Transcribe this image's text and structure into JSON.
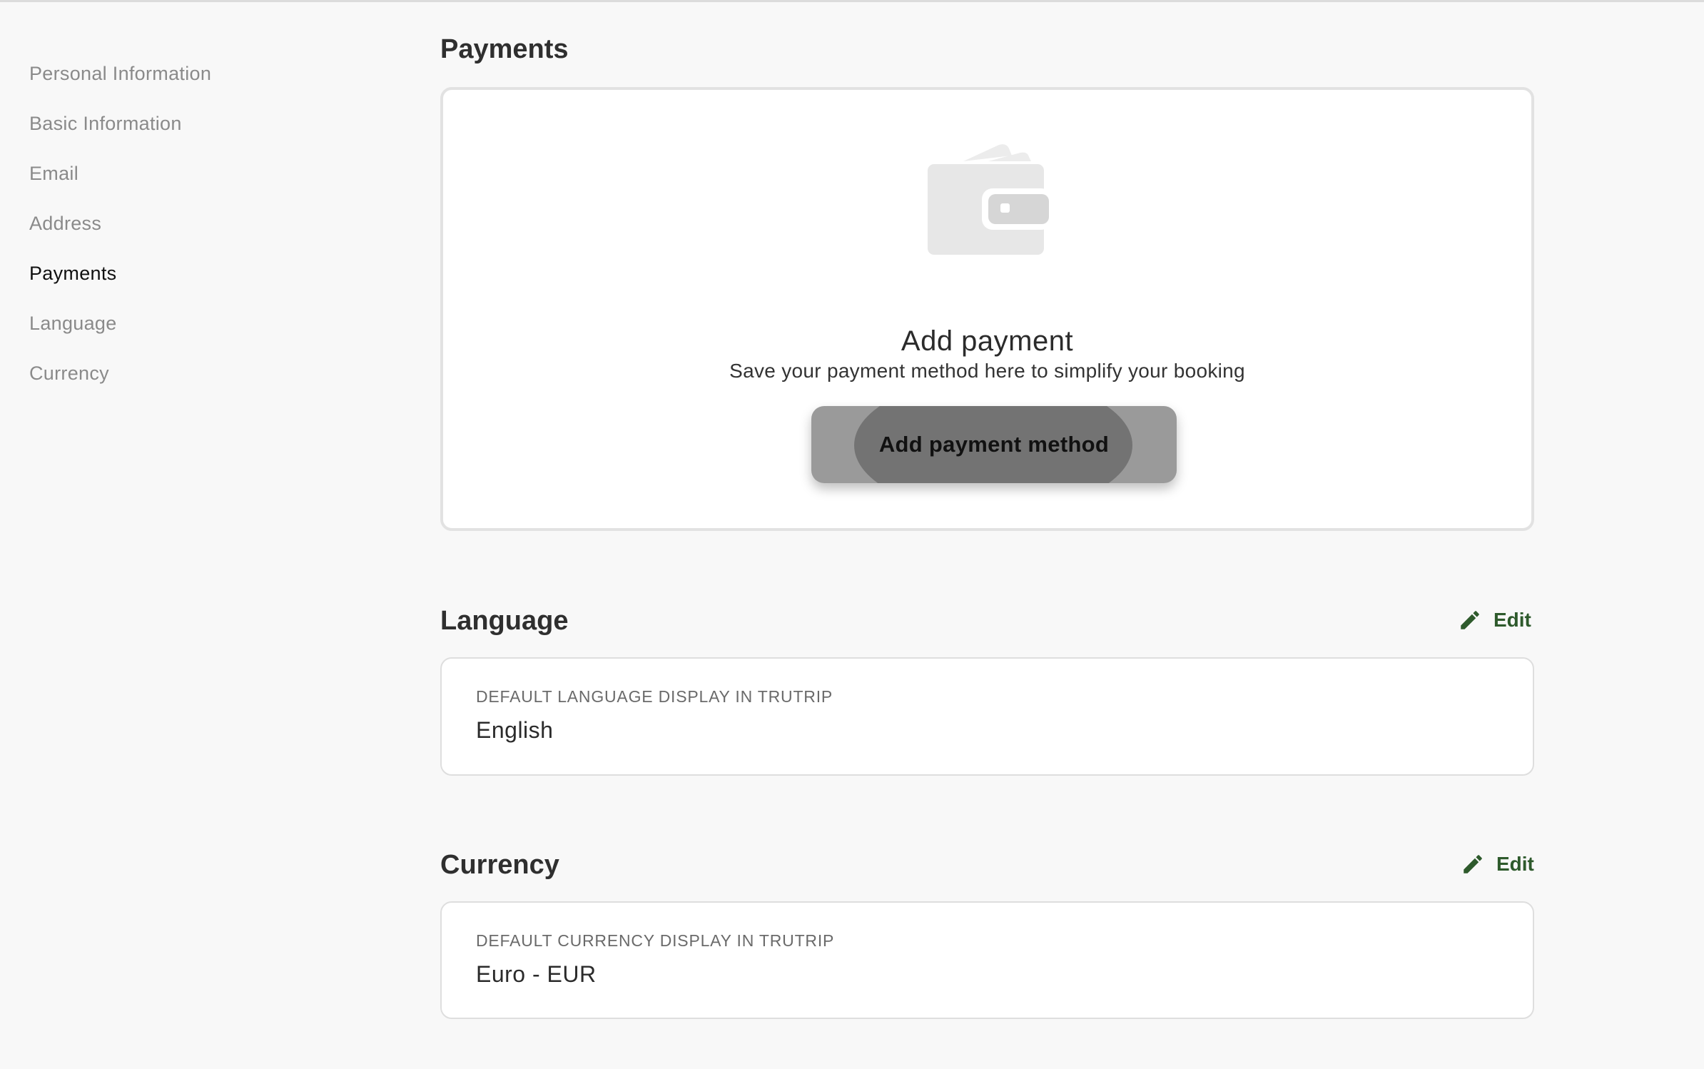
{
  "sidebar": {
    "items": [
      {
        "label": "Personal Information",
        "active": false
      },
      {
        "label": "Basic Information",
        "active": false
      },
      {
        "label": "Email",
        "active": false
      },
      {
        "label": "Address",
        "active": false
      },
      {
        "label": "Payments",
        "active": true
      },
      {
        "label": "Language",
        "active": false
      },
      {
        "label": "Currency",
        "active": false
      }
    ]
  },
  "payments": {
    "title": "Payments",
    "icon": "wallet-icon",
    "empty_title": "Add payment",
    "empty_subtitle": "Save your payment method here to simplify your booking",
    "button_label": "Add payment method"
  },
  "language": {
    "title": "Language",
    "edit_label": "Edit",
    "field_label": "DEFAULT LANGUAGE DISPLAY IN TRUTRIP",
    "value": "English"
  },
  "currency": {
    "title": "Currency",
    "edit_label": "Edit",
    "field_label": "DEFAULT CURRENCY DISPLAY IN TRUTRIP",
    "value": "Euro - EUR"
  },
  "colors": {
    "accent": "#2e5a2c",
    "background": "#f8f8f8",
    "active_nav": "#111111",
    "inactive_nav": "#8a8a8a"
  }
}
